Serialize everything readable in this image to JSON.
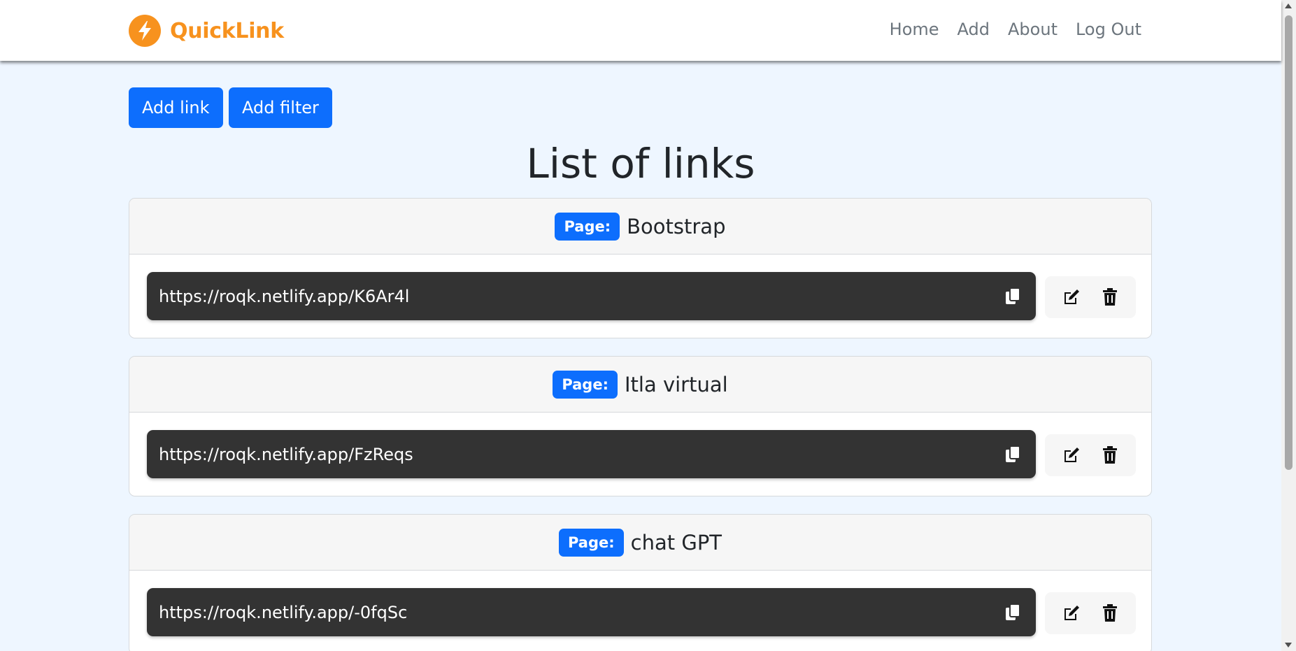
{
  "brand": {
    "name": "QuickLink",
    "color": "#f7921e",
    "icon": "lightning-bolt-icon"
  },
  "nav": {
    "items": [
      {
        "label": "Home"
      },
      {
        "label": "Add"
      },
      {
        "label": "About"
      },
      {
        "label": "Log Out"
      }
    ]
  },
  "toolbar": {
    "add_link_label": "Add link",
    "add_filter_label": "Add filter"
  },
  "main": {
    "title": "List of links"
  },
  "links": [
    {
      "badge": "Page:",
      "page": "Bootstrap",
      "url": "https://roqk.netlify.app/K6Ar4l"
    },
    {
      "badge": "Page:",
      "page": "Itla virtual",
      "url": "https://roqk.netlify.app/FzReqs"
    },
    {
      "badge": "Page:",
      "page": "chat GPT",
      "url": "https://roqk.netlify.app/-0fqSc"
    }
  ],
  "icons": {
    "copy": "copy-icon",
    "edit": "edit-icon",
    "delete": "trash-icon"
  },
  "colors": {
    "primary": "#0d6efd",
    "link_box": "#333333",
    "background": "#eef6ff"
  }
}
